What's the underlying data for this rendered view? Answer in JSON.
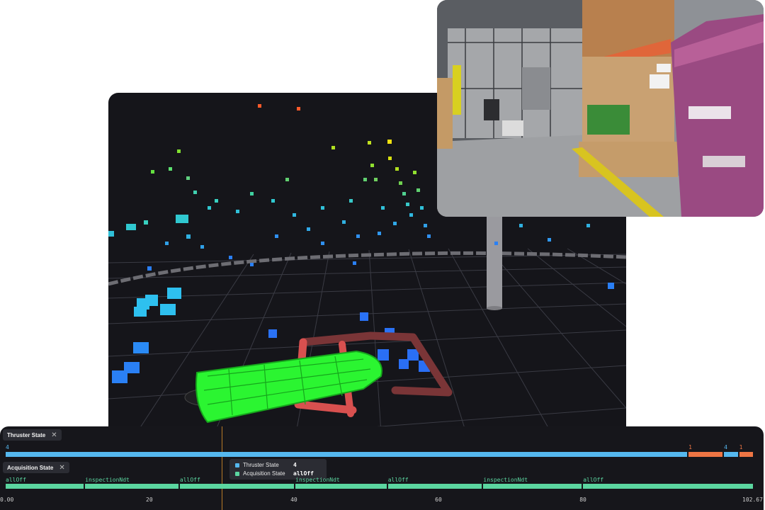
{
  "colors": {
    "thruster_blue": "#55b8ef",
    "thruster_orange": "#ee7544",
    "acquisition_green": "#5bd6a0",
    "robot_green": "#2bf531",
    "path_red": "#d8504f",
    "playhead": "#b87a28"
  },
  "timeline": {
    "thruster_panel": {
      "title": "Thruster State",
      "close_icon": "close-icon",
      "segments": [
        {
          "label": "4",
          "start": 0,
          "end": 94.5,
          "color": "#55b8ef"
        },
        {
          "label": "1",
          "start": 94.5,
          "end": 99.4,
          "color": "#ee7544"
        },
        {
          "label": "4",
          "start": 99.4,
          "end": 101.5,
          "color": "#55b8ef"
        },
        {
          "label": "1",
          "start": 101.5,
          "end": 103.6,
          "color": "#ee7544"
        }
      ]
    },
    "acquisition_panel": {
      "title": "Acquisition State",
      "close_icon": "close-icon",
      "segments": [
        {
          "label": "allOff",
          "start": 0,
          "end": 11.0
        },
        {
          "label": "inspectionNdt",
          "start": 11.0,
          "end": 24.1
        },
        {
          "label": "allOff",
          "start": 24.1,
          "end": 40.1
        },
        {
          "label": "inspectionNdt",
          "start": 40.1,
          "end": 52.9
        },
        {
          "label": "allOff",
          "start": 52.9,
          "end": 66.1
        },
        {
          "label": "inspectionNdt",
          "start": 66.1,
          "end": 79.9
        },
        {
          "label": "allOff",
          "start": 79.9,
          "end": 103.6
        }
      ]
    },
    "axis": {
      "ticks": [
        "0.00",
        "20",
        "40",
        "60",
        "80",
        "102.67"
      ],
      "tick_values": [
        0,
        20,
        40,
        60,
        80,
        102.67
      ],
      "max": 103.6
    },
    "playhead_time": 29.8,
    "tooltip": {
      "rows": [
        {
          "name": "Thruster State",
          "value": "4",
          "color": "#55b8ef"
        },
        {
          "name": "Acquisition State",
          "value": "allOff",
          "color": "#5bd6a0"
        }
      ]
    }
  }
}
